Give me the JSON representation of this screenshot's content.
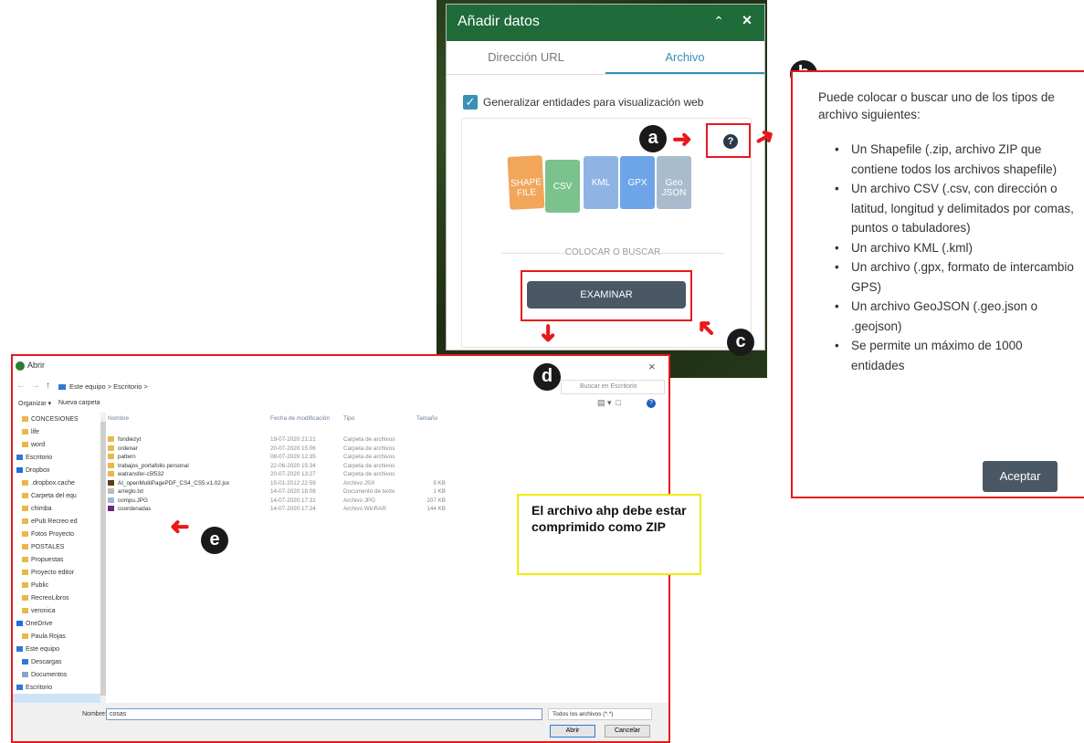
{
  "panel": {
    "title": "Añadir datos",
    "collapse_icon": "double-chevron-up-icon",
    "close_icon": "close-icon",
    "tabs": [
      {
        "label": "Dirección URL",
        "active": false
      },
      {
        "label": "Archivo",
        "active": true
      }
    ],
    "generalize_checkbox": {
      "label": "Generalizar entidades para visualización web",
      "checked": true
    },
    "file_types": [
      {
        "label": "SHAPE FILE",
        "color": "#f2a65a"
      },
      {
        "label": "CSV",
        "color": "#7cc28c"
      },
      {
        "label": "KML",
        "color": "#8fb4e3"
      },
      {
        "label": "GPX",
        "color": "#6ea5e8"
      },
      {
        "label": "Geo JSON",
        "color": "#a9bccd"
      }
    ],
    "drop_text": "COLOCAR O BUSCAR",
    "browse_button": "EXAMINAR",
    "header_color": "#1f6b3a",
    "accent_color": "#3a8fb7"
  },
  "callouts": {
    "a": "a",
    "b": "b",
    "c": "c",
    "d": "d",
    "e": "e"
  },
  "info": {
    "intro": "Puede colocar o buscar uno de los tipos de archivo siguientes:",
    "items": [
      "Un Shapefile (.zip, archivo ZIP que contiene todos los archivos shapefile)",
      "Un archivo CSV (.csv, con dirección o latitud, longitud y delimitados por comas, puntos o tabuladores)",
      "Un archivo KML (.kml)",
      "Un archivo (.gpx, formato de intercambio GPS)",
      "Un archivo GeoJSON (.geo.json o .geojson)",
      "Se permite un máximo de 1000 entidades"
    ],
    "accept_button": "Aceptar"
  },
  "dialog": {
    "title": "Abrir",
    "breadcrumb": "Este equipo  >  Escritorio  >",
    "search_placeholder": "Buscar en Escritorio",
    "organize": "Organizar ▾",
    "new_folder": "Nueva carpeta",
    "nav_items": [
      {
        "label": "CONCESIONES",
        "icon": "folder-icon"
      },
      {
        "label": "life",
        "icon": "folder-icon"
      },
      {
        "label": "word",
        "icon": "folder-icon"
      },
      {
        "label": "Escritorio",
        "icon": "desktop-icon"
      },
      {
        "label": "Dropbox",
        "icon": "dropbox-icon"
      },
      {
        "label": ".dropbox.cache",
        "icon": "folder-icon"
      },
      {
        "label": "Carpeta del equ",
        "icon": "folder-icon"
      },
      {
        "label": "chimba",
        "icon": "folder-icon"
      },
      {
        "label": "ePub Recreo ed",
        "icon": "folder-icon"
      },
      {
        "label": "Fotos Proyecto",
        "icon": "folder-icon"
      },
      {
        "label": "POSTALES",
        "icon": "folder-icon"
      },
      {
        "label": "Propuestas",
        "icon": "folder-icon"
      },
      {
        "label": "Proyecto editor",
        "icon": "folder-icon"
      },
      {
        "label": "Public",
        "icon": "folder-icon"
      },
      {
        "label": "RecreoLibros",
        "icon": "folder-icon"
      },
      {
        "label": "veronica",
        "icon": "folder-icon"
      },
      {
        "label": "OneDrive",
        "icon": "cloud-icon"
      },
      {
        "label": "Paula Rojas",
        "icon": "user-icon"
      },
      {
        "label": "Este equipo",
        "icon": "computer-icon"
      },
      {
        "label": "Descargas",
        "icon": "download-icon"
      },
      {
        "label": "Documentos",
        "icon": "document-icon"
      },
      {
        "label": "Escritorio",
        "icon": "desktop-icon"
      }
    ],
    "columns": [
      "Nombre",
      "Fecha de modificación",
      "Tipo",
      "Tamaño"
    ],
    "files": [
      {
        "name": "fondiezyt",
        "date": "19-07-2020 21:21",
        "type": "Carpeta de archivos",
        "size": "",
        "icon": "folder-icon"
      },
      {
        "name": "ordenar",
        "date": "20-07-2020 15:06",
        "type": "Carpeta de archivos",
        "size": "",
        "icon": "folder-icon"
      },
      {
        "name": "pattern",
        "date": "08-07-2020 12:35",
        "type": "Carpeta de archivos",
        "size": "",
        "icon": "folder-icon"
      },
      {
        "name": "trabajos_portafolio personal",
        "date": "22-06-2020 15:34",
        "type": "Carpeta de archivos",
        "size": "",
        "icon": "folder-icon"
      },
      {
        "name": "watransfer-c5f532",
        "date": "20-07-2020 13:27",
        "type": "Carpeta de archivos",
        "size": "",
        "icon": "folder-icon"
      },
      {
        "name": "AI_openMultiPagePDF_CS4_CS5.v1.02.jsx",
        "date": "15-01-2012 22:59",
        "type": "Archivo JSX",
        "size": "9 KB",
        "icon": "script-icon"
      },
      {
        "name": "arreglo.txt",
        "date": "14-07-2020 18:08",
        "type": "Documento de texto",
        "size": "1 KB",
        "icon": "text-file-icon"
      },
      {
        "name": "compu.JPG",
        "date": "14-07-2020 17:31",
        "type": "Archivo JPG",
        "size": "207 KB",
        "icon": "image-file-icon"
      },
      {
        "name": "coordenadas",
        "date": "14-07-2020 17:24",
        "type": "Archivo WinRAR",
        "size": "144 KB",
        "icon": "archive-icon"
      }
    ],
    "file_name_label": "Nombre:",
    "file_name_value": "cosas",
    "file_type": "Todos los archivos (*.*)",
    "open_button": "Abrir",
    "cancel_button": "Cancelar"
  },
  "note": {
    "text": "El archivo ahp debe estar comprimido como ZIP"
  }
}
